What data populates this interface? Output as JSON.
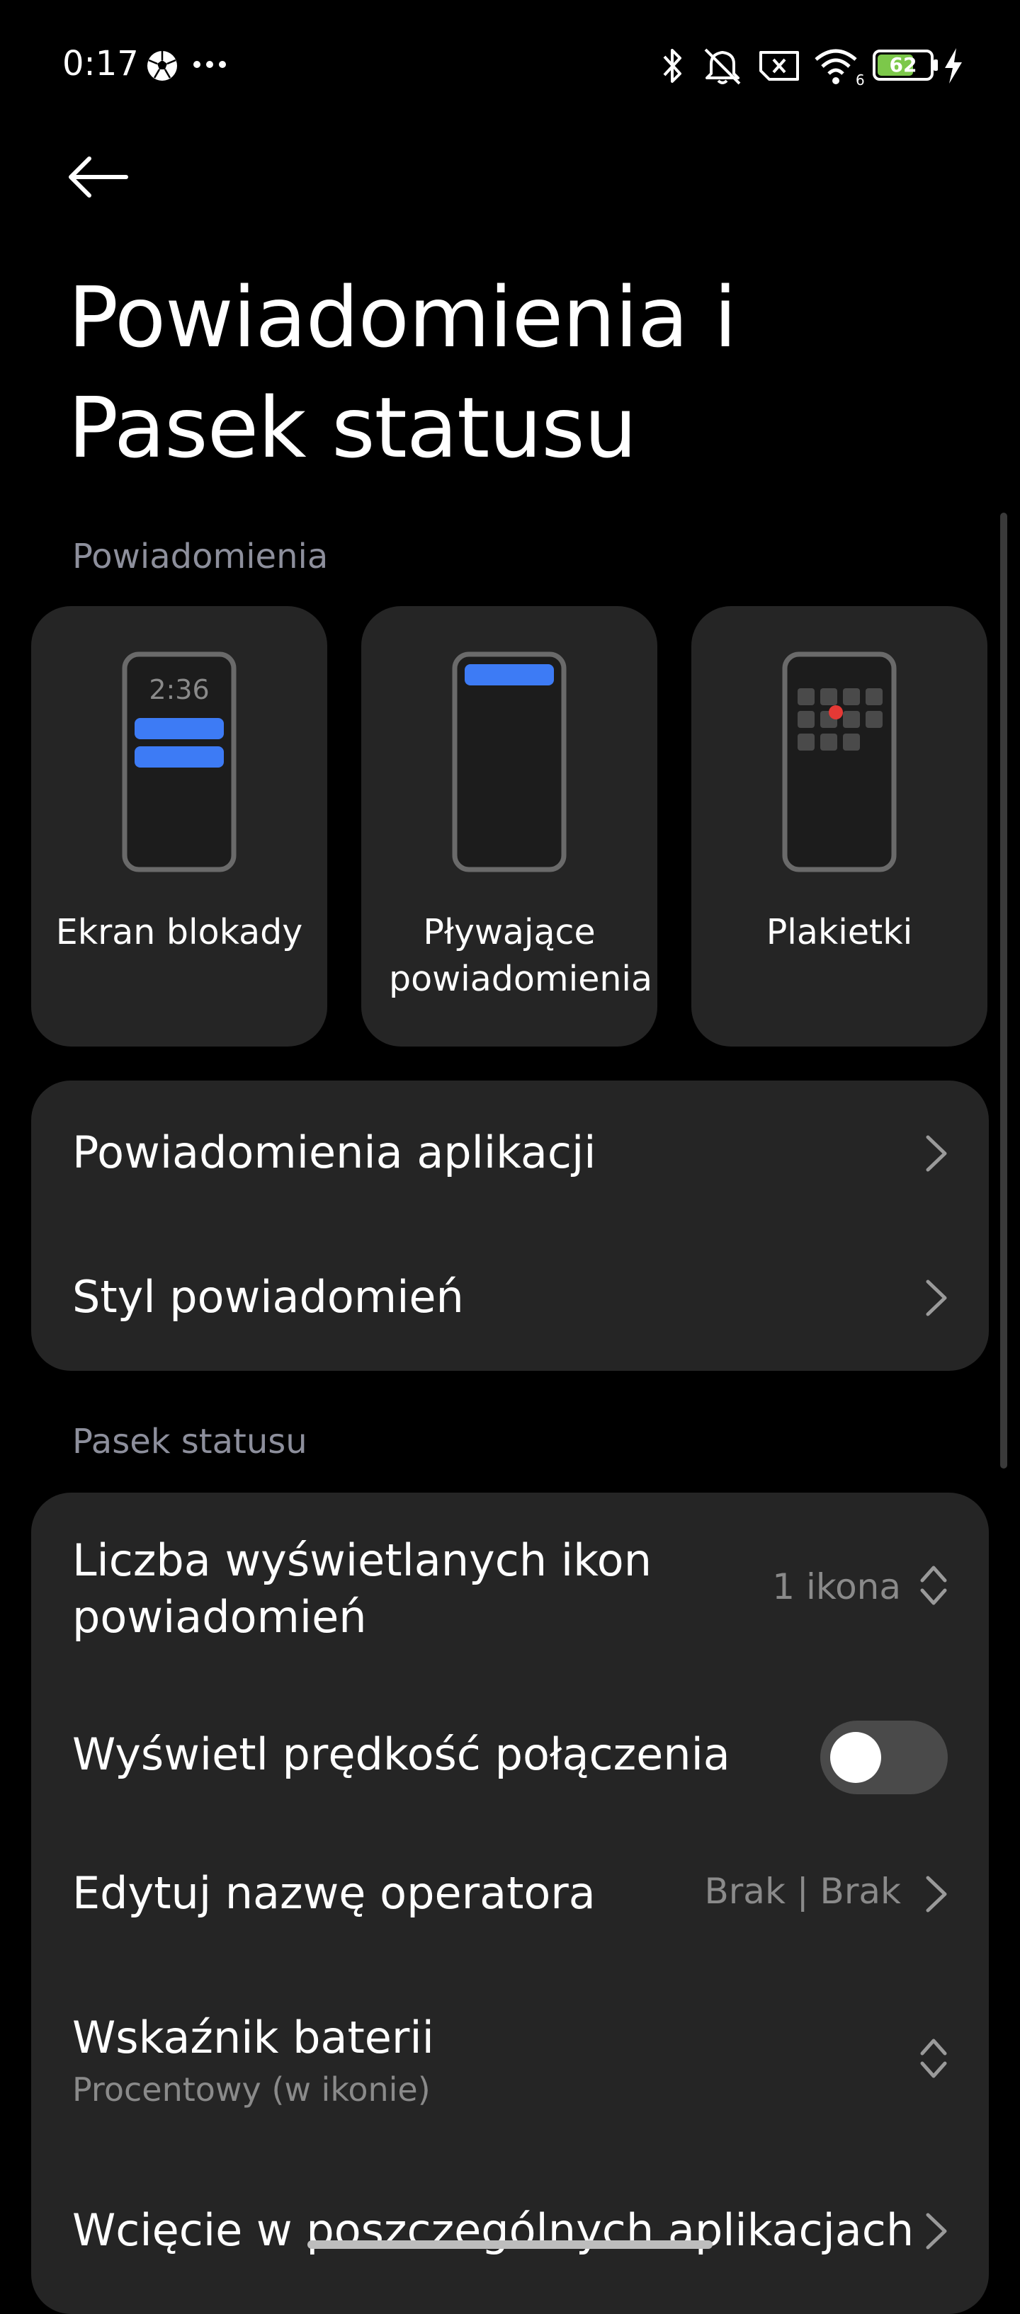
{
  "status_bar": {
    "time": "0:17",
    "battery": "62"
  },
  "page": {
    "title": "Powiadomienia i Pasek statusu"
  },
  "notifications_section": {
    "header": "Powiadomienia",
    "tiles": [
      {
        "label": "Ekran blokady",
        "preview_time": "2:36"
      },
      {
        "label": "Pływające powiadomienia"
      },
      {
        "label": "Plakietki"
      }
    ],
    "items": [
      {
        "label": "Powiadomienia aplikacji"
      },
      {
        "label": "Styl powiadomień"
      }
    ]
  },
  "status_bar_section": {
    "header": "Pasek statusu",
    "items": [
      {
        "label": "Liczba wyświetlanych ikon powiadomień",
        "value": "1 ikona"
      },
      {
        "label": "Wyświetl prędkość połączenia",
        "toggle_on": false
      },
      {
        "label": "Edytuj nazwę operatora",
        "value": "Brak | Brak"
      },
      {
        "label": "Wskaźnik baterii",
        "subtitle": "Procentowy (w ikonie)"
      },
      {
        "label": "Wcięcie w poszczególnych aplikacjach"
      }
    ]
  },
  "colors": {
    "accent": "#3d7bf5",
    "card": "#252525",
    "badge": "#e53935",
    "battery": "#7cc84a"
  }
}
